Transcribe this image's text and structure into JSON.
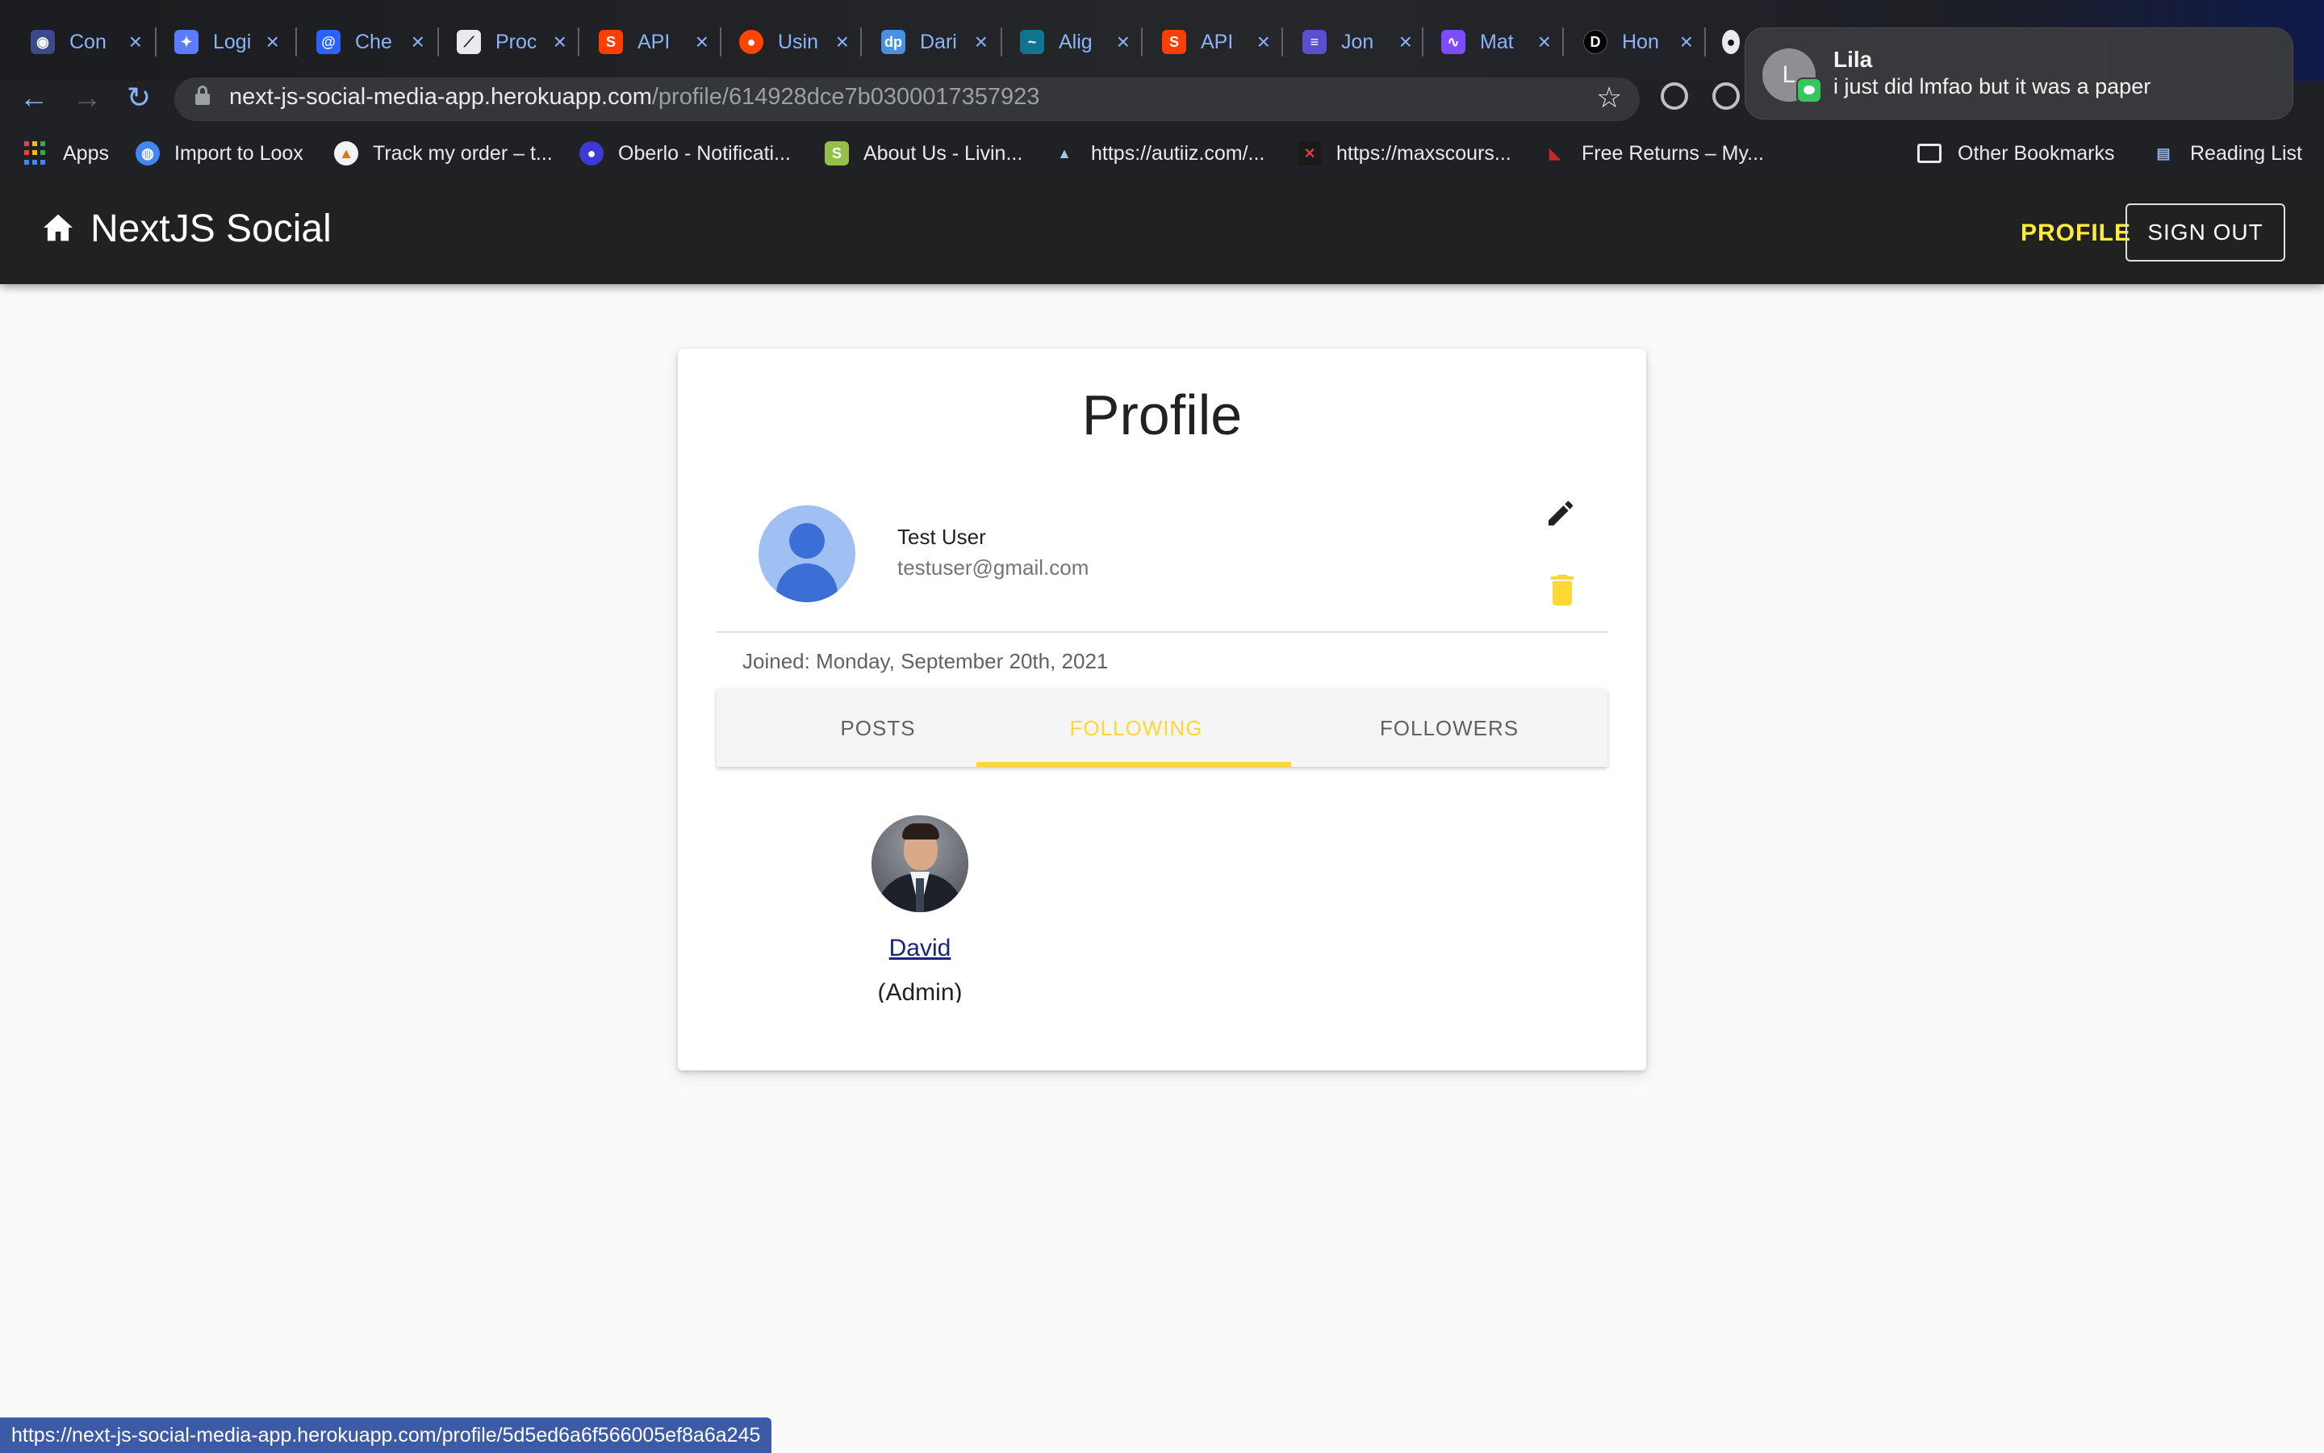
{
  "browser": {
    "tabs": [
      {
        "label": "Con",
        "icon": "app-icon",
        "color": "#4285f4"
      },
      {
        "label": "Logi",
        "icon": "app-icon",
        "color": "#5b7cff"
      },
      {
        "label": "Che",
        "icon": "app-icon",
        "color": "#2962ff"
      },
      {
        "label": "Proc",
        "icon": "app-icon",
        "color": "#9aa0a6"
      },
      {
        "label": "API",
        "icon": "app-icon",
        "color": "#ff3e00"
      },
      {
        "label": "Usin",
        "icon": "reddit-icon",
        "color": "#ff4500"
      },
      {
        "label": "Dari",
        "icon": "app-icon",
        "color": "#4a90e2"
      },
      {
        "label": "Alig",
        "icon": "app-icon",
        "color": "#38bdf8"
      },
      {
        "label": "API",
        "icon": "app-icon",
        "color": "#ff3e00"
      },
      {
        "label": "Jon",
        "icon": "app-icon",
        "color": "#5b4fcf"
      },
      {
        "label": "Mat",
        "icon": "app-icon",
        "color": "#7c4dff"
      },
      {
        "label": "Hon",
        "icon": "app-icon",
        "color": "#000000"
      }
    ],
    "url_host": "next-js-social-media-app.herokuapp.com",
    "url_path": "/profile/614928dce7b0300017357923",
    "bookmarks": [
      {
        "label": "Apps"
      },
      {
        "label": "Import to Loox"
      },
      {
        "label": "Track my order – t..."
      },
      {
        "label": "Oberlo - Notificati..."
      },
      {
        "label": "About Us - Livin..."
      },
      {
        "label": "https://autiiz.com/..."
      },
      {
        "label": "https://maxscours..."
      },
      {
        "label": "Free Returns – My..."
      },
      {
        "label": "Other Bookmarks"
      },
      {
        "label": "Reading List"
      }
    ],
    "status_url": "https://next-js-social-media-app.herokuapp.com/profile/5d5ed6a6f566005ef8a6a245"
  },
  "notification": {
    "avatar_initial": "L",
    "sender": "Lila",
    "message": "i just did lmfao but it was a paper"
  },
  "app": {
    "brand": "NextJS Social",
    "nav_profile": "PROFILE",
    "sign_out": "SIGN OUT",
    "accent_color": "#fdd835"
  },
  "profile": {
    "title": "Profile",
    "name": "Test User",
    "email": "testuser@gmail.com",
    "joined": "Joined: Monday, September 20th, 2021",
    "tabs": [
      "POSTS",
      "FOLLOWING",
      "FOLLOWERS"
    ],
    "active_tab": "FOLLOWING",
    "following": [
      {
        "name": "David",
        "role": "(Admin)"
      }
    ]
  }
}
